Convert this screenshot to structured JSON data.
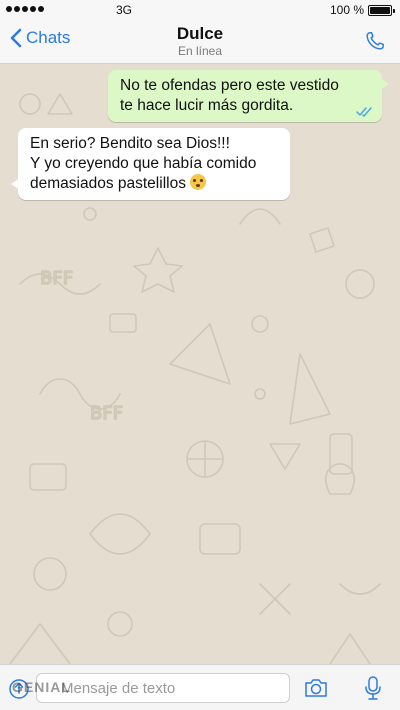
{
  "status_bar": {
    "network": "3G",
    "battery": "100 %",
    "battery_level": 1.0
  },
  "header": {
    "back_label": "Chats",
    "title": "Dulce",
    "subtitle": "En línea"
  },
  "messages": [
    {
      "direction": "outgoing",
      "lines": [
        "No te ofendas pero este vestido",
        "te hace lucir más gordita."
      ],
      "status_icon": "double-check-icon"
    },
    {
      "direction": "incoming",
      "lines": [
        "En serio? Bendito sea Dios!!!",
        "Y yo creyendo que había comido",
        "demasiados pastelillos"
      ],
      "emoji": "flushed-face-icon"
    }
  ],
  "input_bar": {
    "placeholder": "Mensaje de texto",
    "value": ""
  },
  "watermark": "GENIAL",
  "colors": {
    "accent": "#2a7be4",
    "outgoing_bubble": "#dcf8c6",
    "incoming_bubble": "#ffffff",
    "chat_background": "#e5ddd0",
    "read_ticks": "#4fa6e6"
  }
}
